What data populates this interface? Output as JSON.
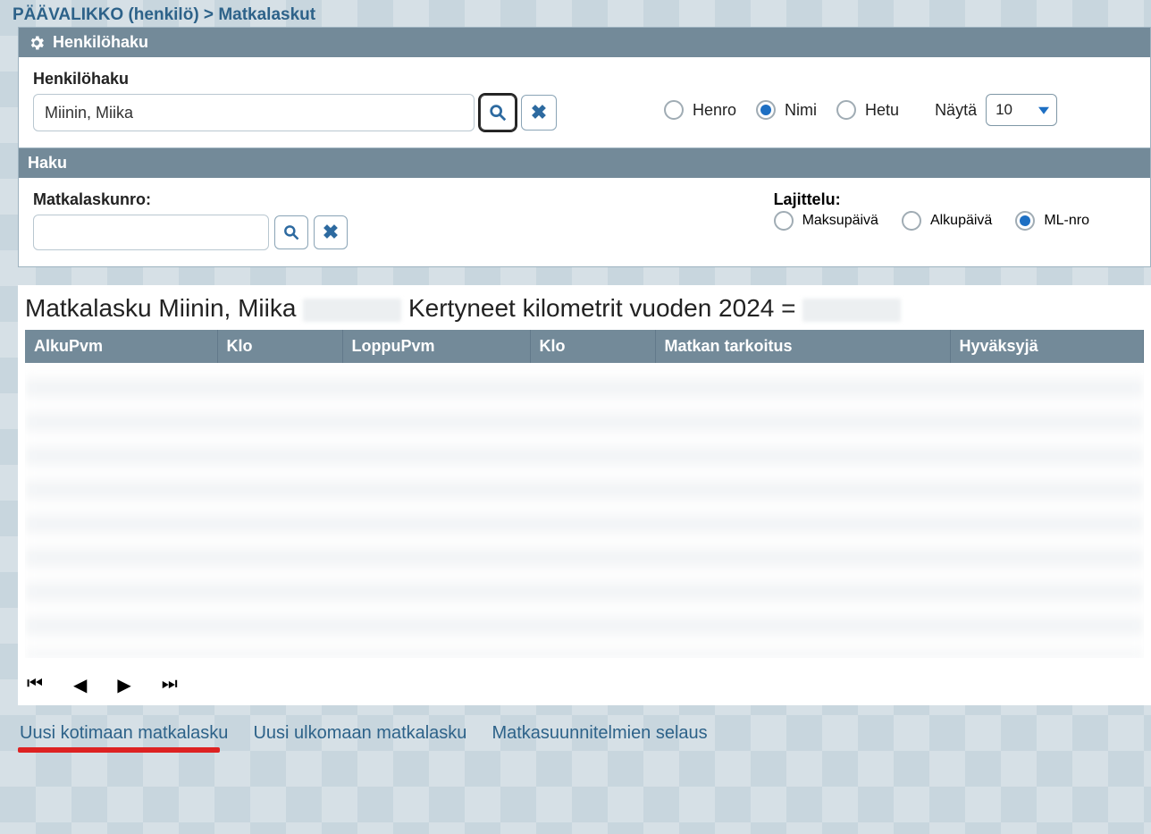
{
  "breadcrumb": {
    "root": "PÄÄVALIKKO (henkilö)",
    "sep": " > ",
    "current": "Matkalaskut"
  },
  "panel1": {
    "title": "Henkilöhaku",
    "label": "Henkilöhaku",
    "searchValue": "Miinin, Miika",
    "radios": {
      "henro": "Henro",
      "nimi": "Nimi",
      "hetu": "Hetu"
    },
    "nayta_label": "Näytä",
    "nayta_value": "10"
  },
  "panel2": {
    "title": "Haku",
    "label": "Matkalaskunro:",
    "searchValue": "",
    "lajittelu_label": "Lajittelu:",
    "radios": {
      "maksupaiva": "Maksupäivä",
      "alkupaiva": "Alkupäivä",
      "mlnro": "ML-nro"
    }
  },
  "content": {
    "title_pre": "Matkalasku  Miinin, Miika ",
    "title_mid": "Kertyneet kilometrit vuoden 2024 = ",
    "columns": [
      "AlkuPvm",
      "Klo",
      "LoppuPvm",
      "Klo",
      "Matkan tarkoitus",
      "Hyväksyjä"
    ]
  },
  "links": {
    "a": "Uusi kotimaan matkalasku",
    "b": "Uusi ulkomaan matkalasku",
    "c": "Matkasuunnitelmien selaus"
  }
}
